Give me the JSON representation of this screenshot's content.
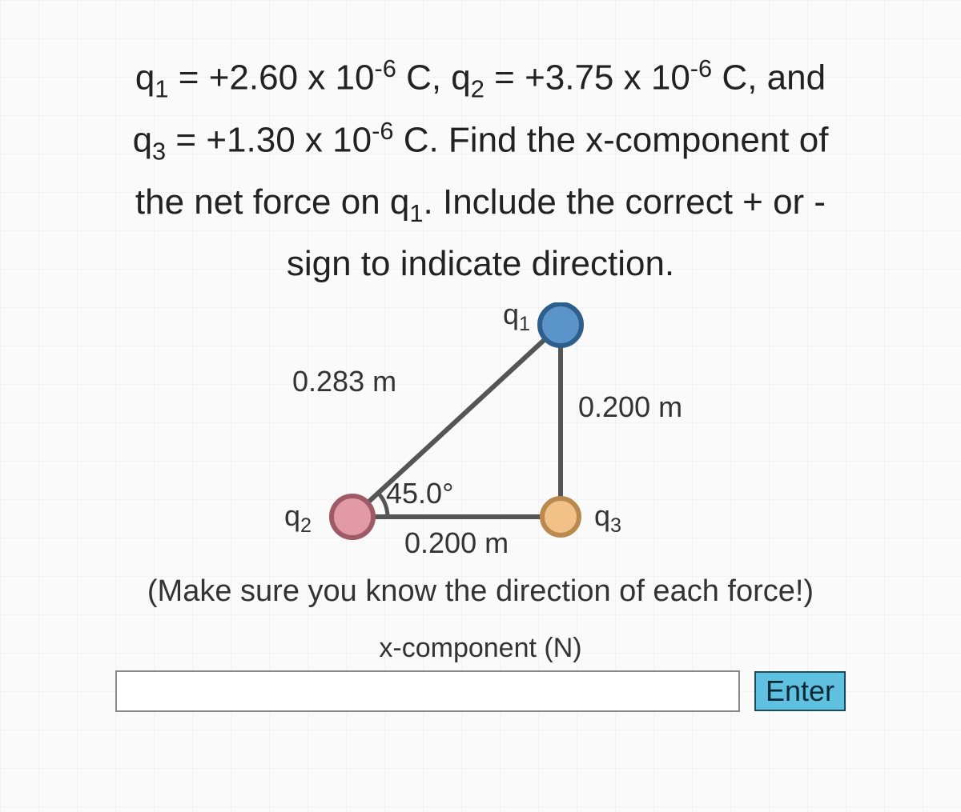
{
  "problem": {
    "q1_value": "+2.60 x 10",
    "q1_exp": "-6",
    "q2_value": "+3.75 x 10",
    "q2_exp": "-6",
    "q3_value": "+1.30 x 10",
    "q3_exp": "-6",
    "unit": "C",
    "and": ", and",
    "line2_tail": ". Find the x-component of",
    "line3": "the net force on q",
    "line3_sub": "1",
    "line3_tail": ". Include the correct + or -",
    "line4": "sign to indicate direction."
  },
  "diagram": {
    "q1_label": "q",
    "q1_sub": "1",
    "q2_label": "q",
    "q2_sub": "2",
    "q3_label": "q",
    "q3_sub": "3",
    "hypotenuse": "0.283 m",
    "vertical": "0.200 m",
    "base": "0.200 m",
    "angle": "45.0°"
  },
  "hint": "(Make sure you know the direction of each force!)",
  "answer": {
    "label": "x-component (N)",
    "value": "",
    "button": "Enter"
  }
}
